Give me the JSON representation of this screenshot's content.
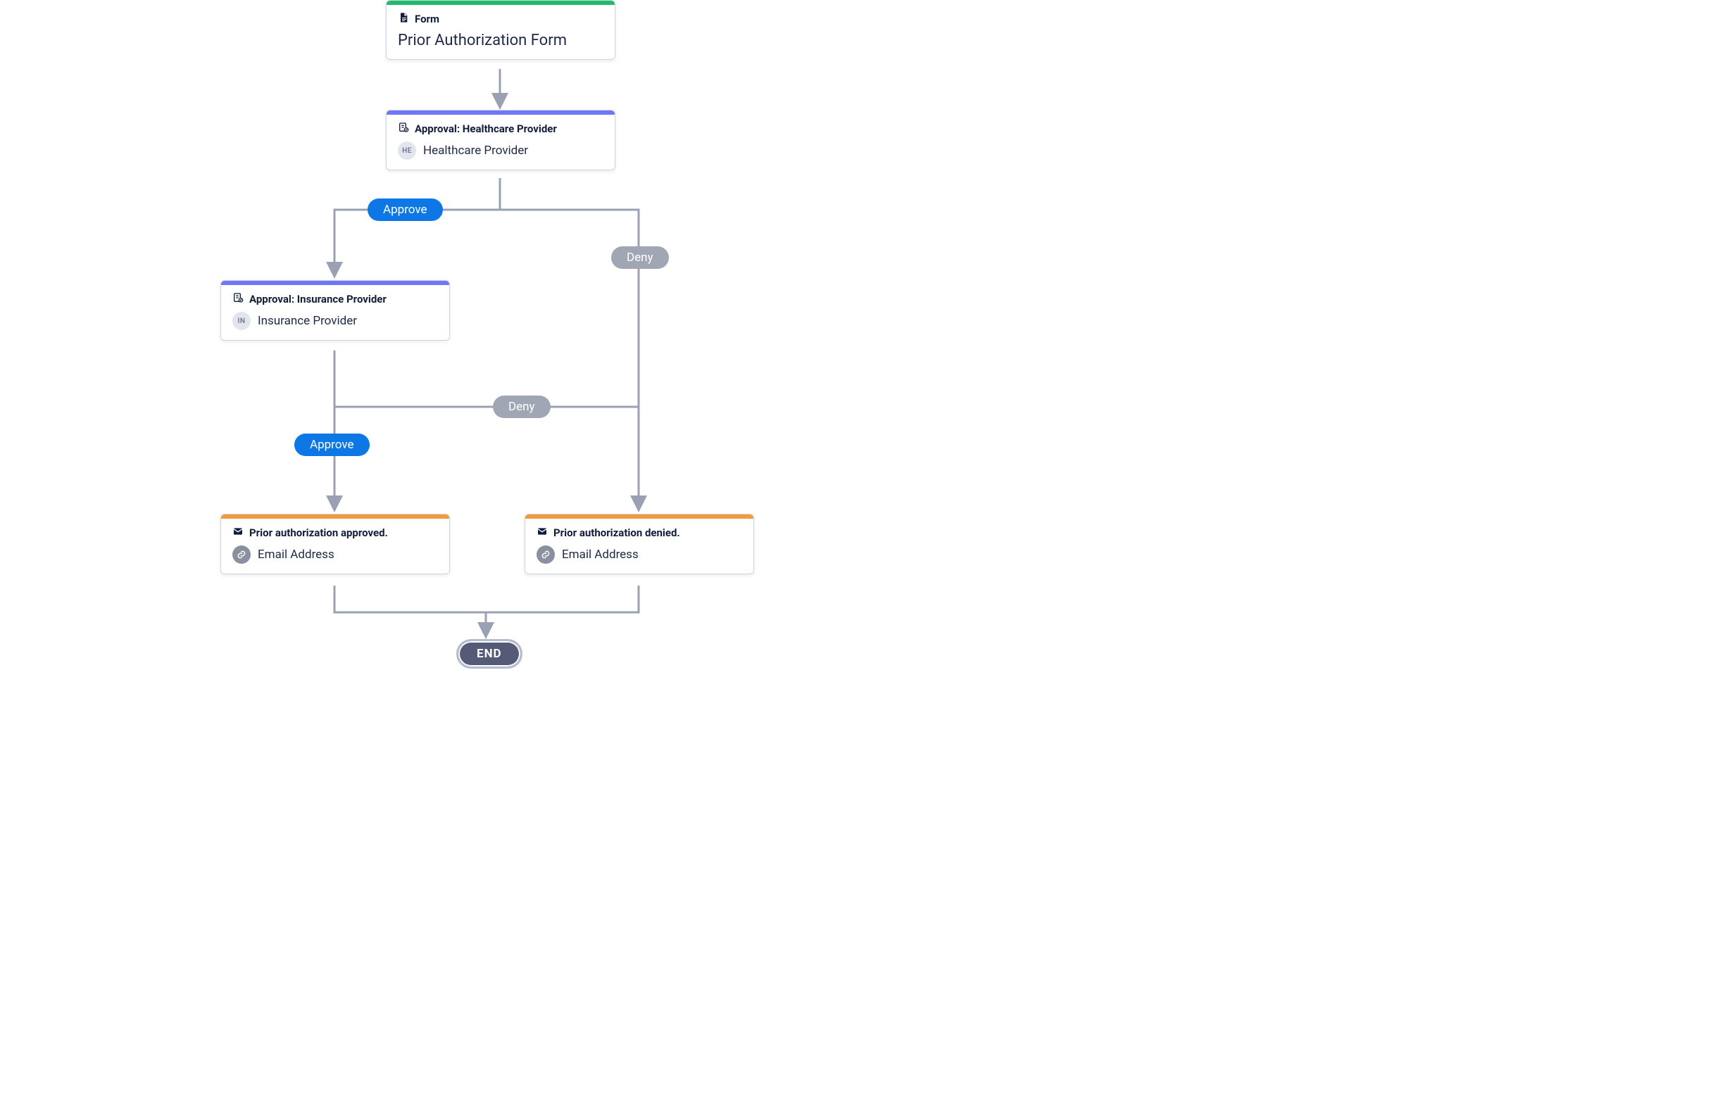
{
  "colors": {
    "accent_form": "#1fba6a",
    "accent_approval": "#6e78f7",
    "accent_email": "#f29a3b",
    "pill_approve": "#0d77e5",
    "pill_deny": "#a0a6b3",
    "end_bg": "#555a77",
    "end_ring": "#b7bbd0",
    "connector": "#9aa1b2"
  },
  "nodes": {
    "form": {
      "type_label": "Form",
      "title": "Prior Authorization Form"
    },
    "approval_healthcare": {
      "header": "Approval: Healthcare Provider",
      "avatar": "HE",
      "assignee": "Healthcare Provider"
    },
    "approval_insurance": {
      "header": "Approval: Insurance Provider",
      "avatar": "IN",
      "assignee": "Insurance Provider"
    },
    "email_approved": {
      "header": "Prior authorization approved.",
      "recipient": "Email Address"
    },
    "email_denied": {
      "header": "Prior authorization denied.",
      "recipient": "Email Address"
    },
    "end": {
      "label": "END"
    }
  },
  "edges": {
    "approve1": "Approve",
    "deny1": "Deny",
    "approve2": "Approve",
    "deny2": "Deny"
  }
}
